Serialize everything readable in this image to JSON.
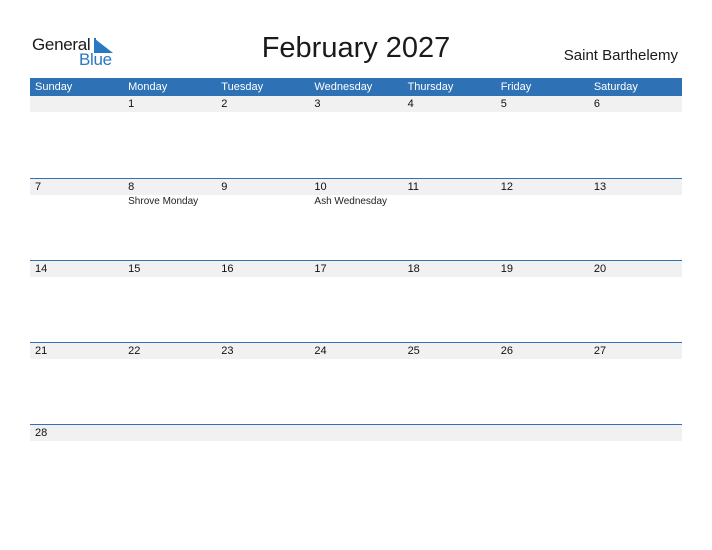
{
  "logo": {
    "general": "General",
    "blue": "Blue"
  },
  "title": "February 2027",
  "country": "Saint Barthelemy",
  "colors": {
    "accent": "#2e72b5",
    "strip": "#f1f1f1"
  },
  "weekdays": [
    "Sunday",
    "Monday",
    "Tuesday",
    "Wednesday",
    "Thursday",
    "Friday",
    "Saturday"
  ],
  "weeks": [
    [
      {
        "day": ""
      },
      {
        "day": "1"
      },
      {
        "day": "2"
      },
      {
        "day": "3"
      },
      {
        "day": "4"
      },
      {
        "day": "5"
      },
      {
        "day": "6"
      }
    ],
    [
      {
        "day": "7"
      },
      {
        "day": "8",
        "event": "Shrove Monday"
      },
      {
        "day": "9"
      },
      {
        "day": "10",
        "event": "Ash Wednesday"
      },
      {
        "day": "11"
      },
      {
        "day": "12"
      },
      {
        "day": "13"
      }
    ],
    [
      {
        "day": "14"
      },
      {
        "day": "15"
      },
      {
        "day": "16"
      },
      {
        "day": "17"
      },
      {
        "day": "18"
      },
      {
        "day": "19"
      },
      {
        "day": "20"
      }
    ],
    [
      {
        "day": "21"
      },
      {
        "day": "22"
      },
      {
        "day": "23"
      },
      {
        "day": "24"
      },
      {
        "day": "25"
      },
      {
        "day": "26"
      },
      {
        "day": "27"
      }
    ],
    [
      {
        "day": "28"
      },
      {
        "day": ""
      },
      {
        "day": ""
      },
      {
        "day": ""
      },
      {
        "day": ""
      },
      {
        "day": ""
      },
      {
        "day": ""
      }
    ]
  ]
}
